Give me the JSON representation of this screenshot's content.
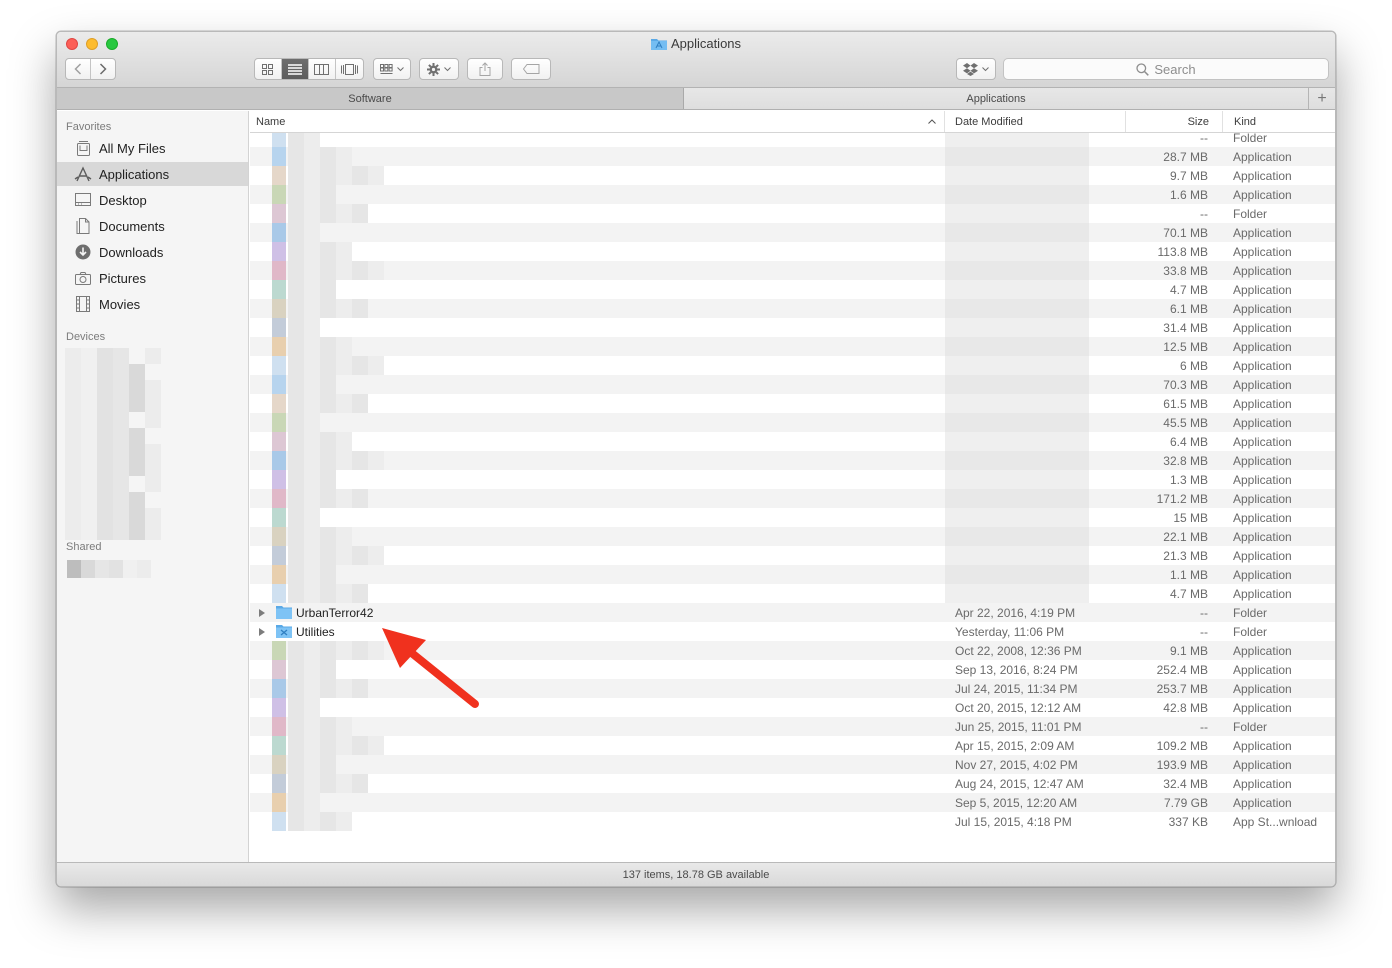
{
  "window": {
    "title": "Applications"
  },
  "toolbar": {
    "back_icon": "chevron-left-icon",
    "forward_icon": "chevron-right-icon",
    "view_modes": [
      "icon-view-icon",
      "list-view-icon",
      "column-view-icon",
      "cover-flow-icon"
    ],
    "selected_view": "list",
    "search_placeholder": "Search"
  },
  "tabs": [
    {
      "label": "Software",
      "active": false
    },
    {
      "label": "Applications",
      "active": true
    }
  ],
  "sidebar": {
    "favorites_header": "Favorites",
    "favorites": [
      {
        "label": "All My Files",
        "icon": "all-files-icon"
      },
      {
        "label": "Applications",
        "icon": "applications-icon",
        "selected": true
      },
      {
        "label": "Desktop",
        "icon": "desktop-icon"
      },
      {
        "label": "Documents",
        "icon": "documents-icon"
      },
      {
        "label": "Downloads",
        "icon": "downloads-icon"
      },
      {
        "label": "Pictures",
        "icon": "pictures-icon"
      },
      {
        "label": "Movies",
        "icon": "movies-icon"
      }
    ],
    "devices_header": "Devices",
    "shared_header": "Shared"
  },
  "columns": {
    "name": "Name",
    "date": "Date Modified",
    "size": "Size",
    "kind": "Kind"
  },
  "rows": [
    {
      "size": "--",
      "kind": "Folder"
    },
    {
      "size": "28.7 MB",
      "kind": "Application"
    },
    {
      "size": "9.7 MB",
      "kind": "Application"
    },
    {
      "size": "1.6 MB",
      "kind": "Application"
    },
    {
      "size": "--",
      "kind": "Folder"
    },
    {
      "size": "70.1 MB",
      "kind": "Application"
    },
    {
      "size": "113.8 MB",
      "kind": "Application"
    },
    {
      "size": "33.8 MB",
      "kind": "Application"
    },
    {
      "size": "4.7 MB",
      "kind": "Application"
    },
    {
      "size": "6.1 MB",
      "kind": "Application"
    },
    {
      "size": "31.4 MB",
      "kind": "Application"
    },
    {
      "size": "12.5 MB",
      "kind": "Application"
    },
    {
      "size": "6 MB",
      "kind": "Application"
    },
    {
      "size": "70.3 MB",
      "kind": "Application"
    },
    {
      "size": "61.5 MB",
      "kind": "Application"
    },
    {
      "size": "45.5 MB",
      "kind": "Application"
    },
    {
      "size": "6.4 MB",
      "kind": "Application"
    },
    {
      "size": "32.8 MB",
      "kind": "Application"
    },
    {
      "size": "1.3 MB",
      "kind": "Application"
    },
    {
      "size": "171.2 MB",
      "kind": "Application"
    },
    {
      "size": "15 MB",
      "kind": "Application"
    },
    {
      "size": "22.1 MB",
      "kind": "Application"
    },
    {
      "size": "21.3 MB",
      "kind": "Application"
    },
    {
      "size": "1.1 MB",
      "kind": "Application"
    },
    {
      "size": "4.7 MB",
      "kind": "Application"
    },
    {
      "name": "UrbanTerror42",
      "date": "Apr 22, 2016, 4:19 PM",
      "size": "--",
      "kind": "Folder",
      "folder": true
    },
    {
      "name": "Utilities",
      "date": "Yesterday, 11:06 PM",
      "size": "--",
      "kind": "Folder",
      "folder": true,
      "utilities": true
    },
    {
      "date": "Oct 22, 2008, 12:36 PM",
      "size": "9.1 MB",
      "kind": "Application"
    },
    {
      "date": "Sep 13, 2016, 8:24 PM",
      "size": "252.4 MB",
      "kind": "Application"
    },
    {
      "date": "Jul 24, 2015, 11:34 PM",
      "size": "253.7 MB",
      "kind": "Application"
    },
    {
      "date": "Oct 20, 2015, 12:12 AM",
      "size": "42.8 MB",
      "kind": "Application"
    },
    {
      "date": "Jun 25, 2015, 11:01 PM",
      "size": "--",
      "kind": "Folder"
    },
    {
      "date": "Apr 15, 2015, 2:09 AM",
      "size": "109.2 MB",
      "kind": "Application"
    },
    {
      "date": "Nov 27, 2015, 4:02 PM",
      "size": "193.9 MB",
      "kind": "Application"
    },
    {
      "date": "Aug 24, 2015, 12:47 AM",
      "size": "32.4 MB",
      "kind": "Application"
    },
    {
      "date": "Sep 5, 2015, 12:20 AM",
      "size": "7.79 GB",
      "kind": "Application"
    },
    {
      "date": "Jul 15, 2015, 4:18 PM",
      "size": "337 KB",
      "kind": "App St...wnload"
    }
  ],
  "status": {
    "text": "137 items, 18.78 GB available"
  },
  "colors": {
    "arrow": "#f0311e",
    "selection": "#d8d8d8",
    "folder": "#5aa9e6"
  }
}
